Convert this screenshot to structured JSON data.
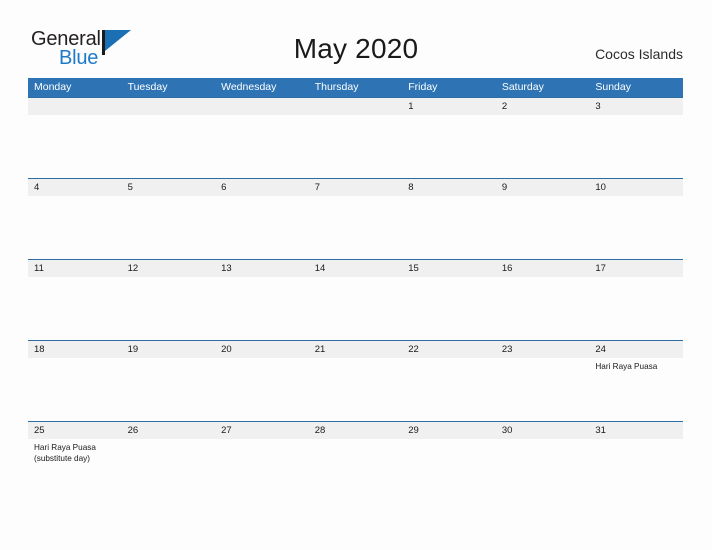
{
  "logo": {
    "word_top": "General",
    "word_bottom": "Blue",
    "flag_icon": "blue-triangle-flag-icon"
  },
  "header": {
    "title": "May 2020",
    "location": "Cocos Islands"
  },
  "colors": {
    "header_blue": "#2e74b5",
    "row_rule_blue": "#2e6da4",
    "date_band_gray": "#f0f0f0",
    "logo_blue": "#1d7ac9",
    "page_background": "#fdfdfd",
    "text_dark": "#1a1a1a"
  },
  "weekdays": [
    {
      "label": "Monday"
    },
    {
      "label": "Tuesday"
    },
    {
      "label": "Wednesday"
    },
    {
      "label": "Thursday"
    },
    {
      "label": "Friday"
    },
    {
      "label": "Saturday"
    },
    {
      "label": "Sunday"
    }
  ],
  "weeks": [
    {
      "days": [
        {
          "date": "",
          "events": []
        },
        {
          "date": "",
          "events": []
        },
        {
          "date": "",
          "events": []
        },
        {
          "date": "",
          "events": []
        },
        {
          "date": "1",
          "events": []
        },
        {
          "date": "2",
          "events": []
        },
        {
          "date": "3",
          "events": []
        }
      ]
    },
    {
      "days": [
        {
          "date": "4",
          "events": []
        },
        {
          "date": "5",
          "events": []
        },
        {
          "date": "6",
          "events": []
        },
        {
          "date": "7",
          "events": []
        },
        {
          "date": "8",
          "events": []
        },
        {
          "date": "9",
          "events": []
        },
        {
          "date": "10",
          "events": []
        }
      ]
    },
    {
      "days": [
        {
          "date": "11",
          "events": []
        },
        {
          "date": "12",
          "events": []
        },
        {
          "date": "13",
          "events": []
        },
        {
          "date": "14",
          "events": []
        },
        {
          "date": "15",
          "events": []
        },
        {
          "date": "16",
          "events": []
        },
        {
          "date": "17",
          "events": []
        }
      ]
    },
    {
      "days": [
        {
          "date": "18",
          "events": []
        },
        {
          "date": "19",
          "events": []
        },
        {
          "date": "20",
          "events": []
        },
        {
          "date": "21",
          "events": []
        },
        {
          "date": "22",
          "events": []
        },
        {
          "date": "23",
          "events": []
        },
        {
          "date": "24",
          "events": [
            "Hari Raya Puasa"
          ]
        }
      ]
    },
    {
      "days": [
        {
          "date": "25",
          "events": [
            "Hari Raya Puasa",
            "(substitute day)"
          ]
        },
        {
          "date": "26",
          "events": []
        },
        {
          "date": "27",
          "events": []
        },
        {
          "date": "28",
          "events": []
        },
        {
          "date": "29",
          "events": []
        },
        {
          "date": "30",
          "events": []
        },
        {
          "date": "31",
          "events": []
        }
      ]
    }
  ]
}
